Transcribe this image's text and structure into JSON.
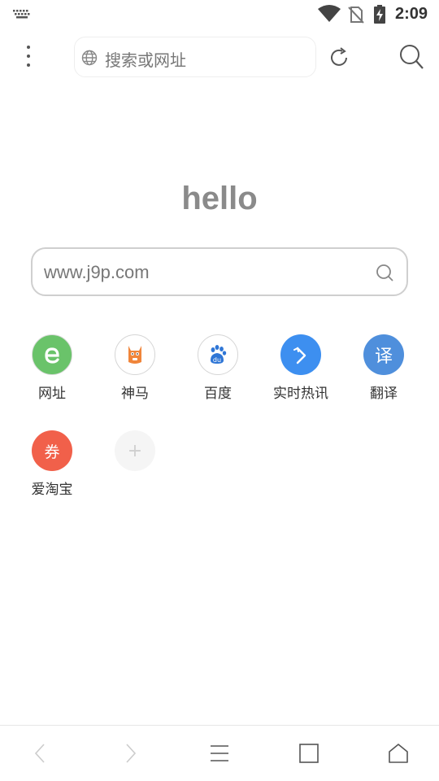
{
  "status_bar": {
    "time": "2:09",
    "icons": [
      "keyboard-icon",
      "wifi-icon",
      "no-sim-icon",
      "battery-charging-icon"
    ]
  },
  "toolbar": {
    "address_placeholder": "搜索或网址"
  },
  "hello": "hello",
  "search": {
    "value": "www.j9p.com"
  },
  "shortcuts": [
    {
      "label": "网址",
      "icon": "e-icon",
      "color": "#6ac36a"
    },
    {
      "label": "神马",
      "icon": "shenma-icon",
      "color": "#f0853a"
    },
    {
      "label": "百度",
      "icon": "baidu-paw-icon",
      "color": "#2f76d6"
    },
    {
      "label": "实时热讯",
      "icon": "arrow-icon",
      "color": "#3d8ff0",
      "glyph": ""
    },
    {
      "label": "翻译",
      "icon": "translate-icon",
      "color": "#4f8fdc",
      "glyph": "译"
    },
    {
      "label": "爱淘宝",
      "icon": "coupon-icon",
      "color": "#f1604a",
      "glyph": "券"
    },
    {
      "label": "",
      "icon": "add-icon",
      "color": "#f5f5f5",
      "glyph": "+"
    }
  ],
  "bottom_nav": [
    "back-icon",
    "forward-icon",
    "menu-icon",
    "tabs-icon",
    "home-icon"
  ]
}
